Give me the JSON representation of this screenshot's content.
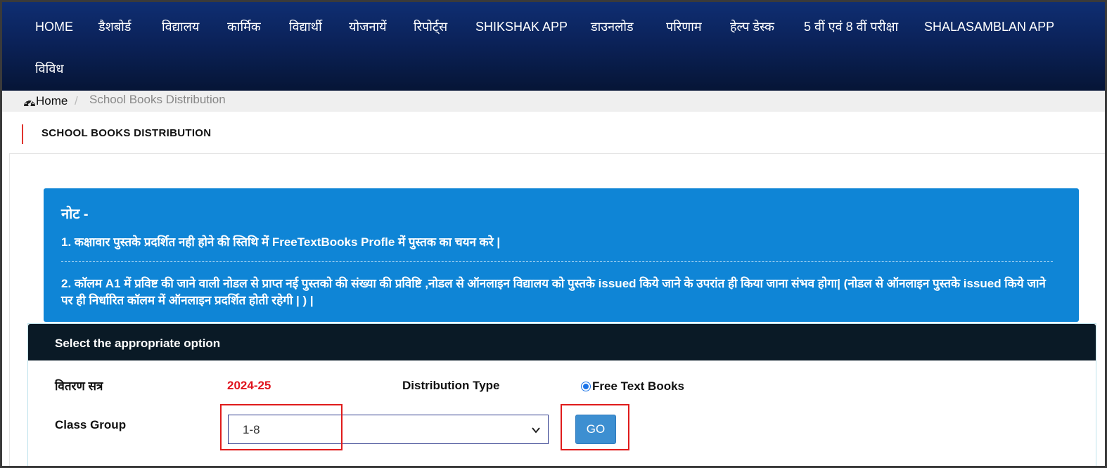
{
  "nav": {
    "items": [
      "HOME",
      "डैशबोर्ड",
      "विद्यालय",
      "कार्मिक",
      "विद्यार्थी",
      "योजनायें",
      "रिपोर्ट्स",
      "SHIKSHAK APP",
      "डाउनलोड",
      "परिणाम",
      "हेल्प डेस्क",
      "5 वीं एवं 8 वीं परीक्षा",
      "SHALASAMBLAN APP",
      "विविध"
    ]
  },
  "breadcrumb": {
    "home": "Home",
    "separator": "/",
    "current": "School Books Distribution",
    "home_icon": "dashboard-gauge-icon"
  },
  "page": {
    "title": "SCHOOL BOOKS DISTRIBUTION",
    "accent_color": "#e0342e"
  },
  "note": {
    "title": "नोट -",
    "line1": "1. कक्षावार पुस्तके प्रदर्शित नही होने की स्तिथि में FreeTextBooks Profle में पुस्तक का चयन करे |",
    "line2": "2. कॉलम A1 में प्रविष्ट की जाने वाली नोडल से प्राप्त नई पुस्तको की संख्या की प्रविष्टि ,नोडल से ऑनलाइन विद्यालय को पुस्तके issued किये जाने के उपरांत ही किया जाना संभव होगा| (नोडल से ऑनलाइन पुस्तके issued किये जाने पर ही निर्धारित कॉलम में ऑनलाइन प्रदर्शित होती रहेगी | ) |",
    "background": "#0f85d6"
  },
  "panel": {
    "title": "Select the appropriate option",
    "session_label": "वितरण सत्र",
    "session_value": "2024-25",
    "distribution_type_label": "Distribution Type",
    "distribution_option": "Free Text Books",
    "distribution_selected": true,
    "class_group_label": "Class Group",
    "class_group_value": "1-8",
    "go_label": "GO"
  },
  "colors": {
    "nav_top": "#0f2e72",
    "nav_bottom": "#061536",
    "session_value": "#e0141e",
    "go_button": "#3d8fd1",
    "highlight": "#e01b1b"
  }
}
